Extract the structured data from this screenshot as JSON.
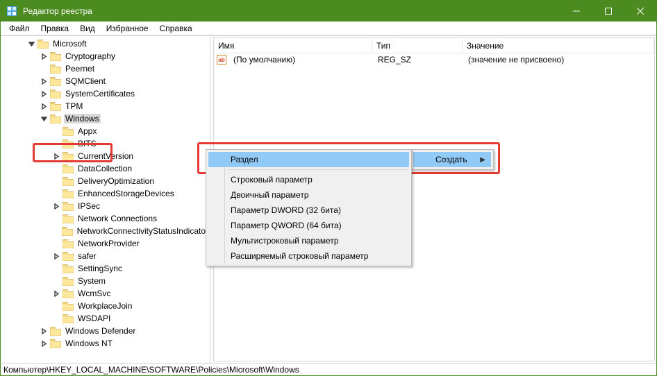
{
  "window": {
    "title": "Редактор реестра"
  },
  "menu": {
    "file": "Файл",
    "edit": "Правка",
    "view": "Вид",
    "favorites": "Избранное",
    "help": "Справка"
  },
  "status": "Компьютер\\HKEY_LOCAL_MACHINE\\SOFTWARE\\Policies\\Microsoft\\Windows",
  "list": {
    "cols": {
      "name": "Имя",
      "type": "Тип",
      "value": "Значение"
    },
    "rows": [
      {
        "name": "(По умолчанию)",
        "type": "REG_SZ",
        "value": "(значение не присвоено)"
      }
    ]
  },
  "ctx1": {
    "create": "Создать"
  },
  "ctx2": {
    "section": "Раздел",
    "string": "Строковый параметр",
    "binary": "Двоичный параметр",
    "dword": "Параметр DWORD (32 бита)",
    "qword": "Параметр QWORD (64 бита)",
    "multi": "Мультистроковый параметр",
    "expand": "Расширяемый строковый параметр"
  },
  "tree": {
    "microsoft": "Microsoft",
    "cryptography": "Cryptography",
    "peernet": "Peernet",
    "sqmclient": "SQMClient",
    "systemcertificates": "SystemCertificates",
    "tpm": "TPM",
    "windows": "Windows",
    "appx": "Appx",
    "bits": "BITS",
    "currentversion": "CurrentVersion",
    "datacollection": "DataCollection",
    "deliveryoptimization": "DeliveryOptimization",
    "enhancedstoragedevices": "EnhancedStorageDevices",
    "ipsec": "IPSec",
    "networkconnections": "Network Connections",
    "networkconnectivity": "NetworkConnectivityStatusIndicator",
    "networkprovider": "NetworkProvider",
    "safer": "safer",
    "settingsync": "SettingSync",
    "system": "System",
    "wcmsvc": "WcmSvc",
    "workplacejoin": "WorkplaceJoin",
    "wsdapi": "WSDAPI",
    "windowsdefender": "Windows Defender",
    "windowsnt": "Windows NT"
  }
}
